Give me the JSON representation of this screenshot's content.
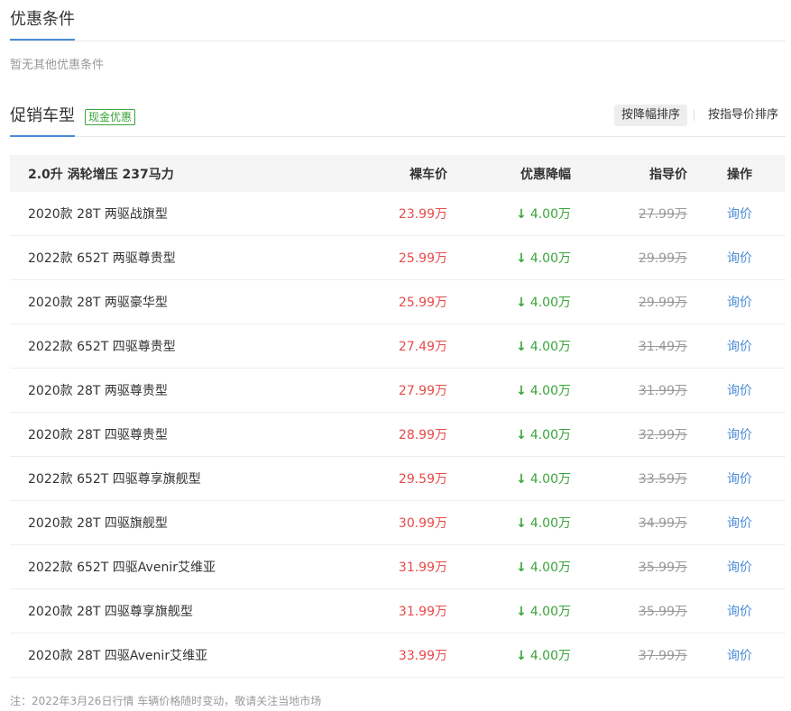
{
  "offer_section": {
    "title": "优惠条件",
    "empty_text": "暂无其他优惠条件"
  },
  "promo_section": {
    "title": "促销车型",
    "tag": "现金优惠",
    "sort_options": [
      "按降幅排序",
      "按指导价排序"
    ],
    "active_sort": 0
  },
  "table": {
    "group_header": "2.0升 涡轮增压 237马力",
    "columns": {
      "price": "裸车价",
      "discount": "优惠降幅",
      "guide": "指导价",
      "action": "操作"
    },
    "rows": [
      {
        "name": "2020款 28T 两驱战旗型",
        "price": "23.99万",
        "discount": "4.00万",
        "guide": "27.99万",
        "action": "询价"
      },
      {
        "name": "2022款 652T 两驱尊贵型",
        "price": "25.99万",
        "discount": "4.00万",
        "guide": "29.99万",
        "action": "询价"
      },
      {
        "name": "2020款 28T 两驱豪华型",
        "price": "25.99万",
        "discount": "4.00万",
        "guide": "29.99万",
        "action": "询价"
      },
      {
        "name": "2022款 652T 四驱尊贵型",
        "price": "27.49万",
        "discount": "4.00万",
        "guide": "31.49万",
        "action": "询价"
      },
      {
        "name": "2020款 28T 两驱尊贵型",
        "price": "27.99万",
        "discount": "4.00万",
        "guide": "31.99万",
        "action": "询价"
      },
      {
        "name": "2020款 28T 四驱尊贵型",
        "price": "28.99万",
        "discount": "4.00万",
        "guide": "32.99万",
        "action": "询价"
      },
      {
        "name": "2022款 652T 四驱尊享旗舰型",
        "price": "29.59万",
        "discount": "4.00万",
        "guide": "33.59万",
        "action": "询价"
      },
      {
        "name": "2020款 28T 四驱旗舰型",
        "price": "30.99万",
        "discount": "4.00万",
        "guide": "34.99万",
        "action": "询价"
      },
      {
        "name": "2022款 652T 四驱Avenir艾维亚",
        "price": "31.99万",
        "discount": "4.00万",
        "guide": "35.99万",
        "action": "询价"
      },
      {
        "name": "2020款 28T 四驱尊享旗舰型",
        "price": "31.99万",
        "discount": "4.00万",
        "guide": "35.99万",
        "action": "询价"
      },
      {
        "name": "2020款 28T 四驱Avenir艾维亚",
        "price": "33.99万",
        "discount": "4.00万",
        "guide": "37.99万",
        "action": "询价"
      }
    ]
  },
  "footnote": "注：2022年3月26日行情 车辆价格随时变动，敬请关注当地市场",
  "colors": {
    "accent": "#4a8bd6",
    "price_red": "#e84a4a",
    "discount_green": "#3aa53a",
    "muted": "#999999"
  },
  "icons": {
    "discount_arrow": "arrow-down-icon"
  }
}
